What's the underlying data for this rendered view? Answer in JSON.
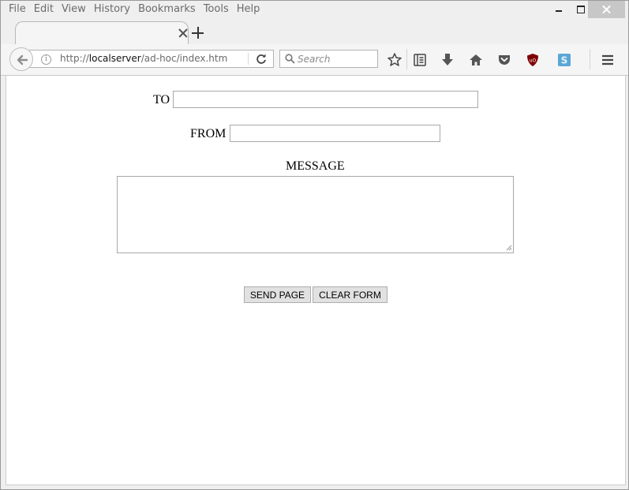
{
  "menu": {
    "items": [
      "File",
      "Edit",
      "View",
      "History",
      "Bookmarks",
      "Tools",
      "Help"
    ]
  },
  "tab": {
    "title": ""
  },
  "address": {
    "scheme": "http://",
    "host": "localserver",
    "path": "/ad-hoc/index.htm"
  },
  "search": {
    "placeholder": "Search"
  },
  "icons": {
    "back": "back-arrow-icon",
    "info": "info-icon",
    "reload": "reload-icon",
    "search": "magnifier-icon",
    "bookmark": "star-icon",
    "reader": "reading-list-icon",
    "downloads": "download-arrow-icon",
    "home": "home-icon",
    "pocket": "pocket-icon",
    "ublock": "ublock-shield-icon",
    "extension": "s-extension-icon",
    "menu": "hamburger-icon"
  },
  "colors": {
    "ublock": "#7f0000",
    "extension": "#5aa6d6"
  },
  "form": {
    "to_label": "TO",
    "to_value": "",
    "from_label": "FROM",
    "from_value": "",
    "message_label": "MESSAGE",
    "message_value": "",
    "send_label": "SEND PAGE",
    "clear_label": "CLEAR FORM"
  }
}
